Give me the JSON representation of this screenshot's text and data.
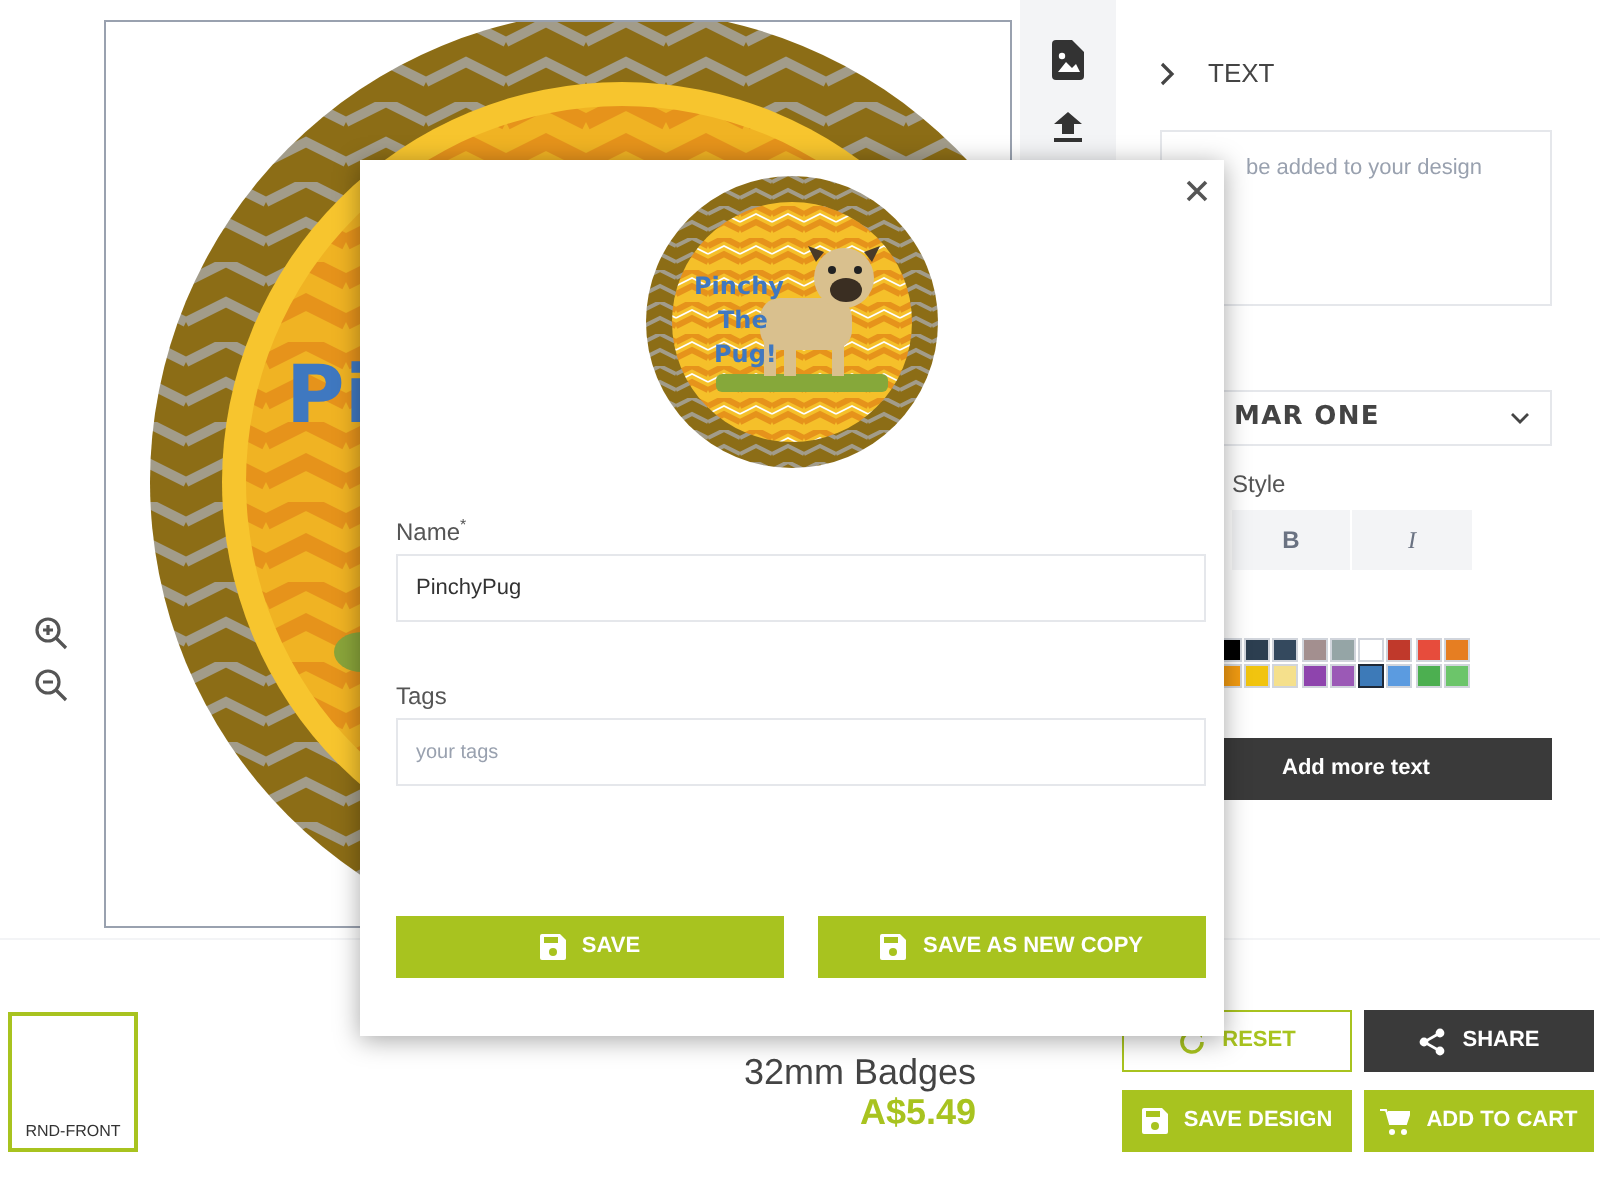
{
  "canvas": {
    "badge_text": "Pi"
  },
  "text_panel": {
    "header": "TEXT",
    "placeholder": "be added to your design",
    "font": "MAR ONE",
    "style_label": "Style",
    "bold_label": "B",
    "italic_label": "I",
    "palette": [
      {
        "color": "#000000",
        "selected": false
      },
      {
        "color": "#2c3e50",
        "selected": false
      },
      {
        "color": "#34495e",
        "selected": false
      },
      {
        "color": "#a38f8f",
        "selected": false
      },
      {
        "color": "#95a5a6",
        "selected": false
      },
      {
        "color": "#ffffff",
        "selected": false
      },
      {
        "color": "#c0392b",
        "selected": false
      },
      {
        "color": "#e74c3c",
        "selected": false
      },
      {
        "color": "#e67e22",
        "selected": false
      },
      {
        "color": "#f39c12",
        "selected": false
      },
      {
        "color": "#f1c40f",
        "selected": false
      },
      {
        "color": "#f5e08c",
        "selected": false
      },
      {
        "color": "#8e44ad",
        "selected": false
      },
      {
        "color": "#9b59b6",
        "selected": false
      },
      {
        "color": "#3d7ab8",
        "selected": true
      },
      {
        "color": "#5b9be0",
        "selected": false
      },
      {
        "color": "#4caf50",
        "selected": false
      },
      {
        "color": "#6cc56a",
        "selected": false
      }
    ],
    "add_button": "Add more text"
  },
  "product": {
    "thumbnail_label": "RND-FRONT",
    "title_lines": [
      "32mm Badges"
    ],
    "price": "A$5.49"
  },
  "actions": [
    {
      "label": "RESET",
      "kind": "outline"
    },
    {
      "label": "SHARE",
      "kind": "dark"
    },
    {
      "label": "SAVE DESIGN",
      "kind": "green"
    },
    {
      "label": "ADD TO CART",
      "kind": "green"
    }
  ],
  "dialog": {
    "preview_text": [
      "Pinchy",
      "The",
      "Pug!"
    ],
    "name_label": "Name",
    "required_mark": "*",
    "name_value": "PinchyPug",
    "tags_label": "Tags",
    "tags_placeholder": "your tags",
    "buttons": [
      {
        "label": "SAVE"
      },
      {
        "label": "SAVE AS NEW COPY"
      }
    ]
  }
}
